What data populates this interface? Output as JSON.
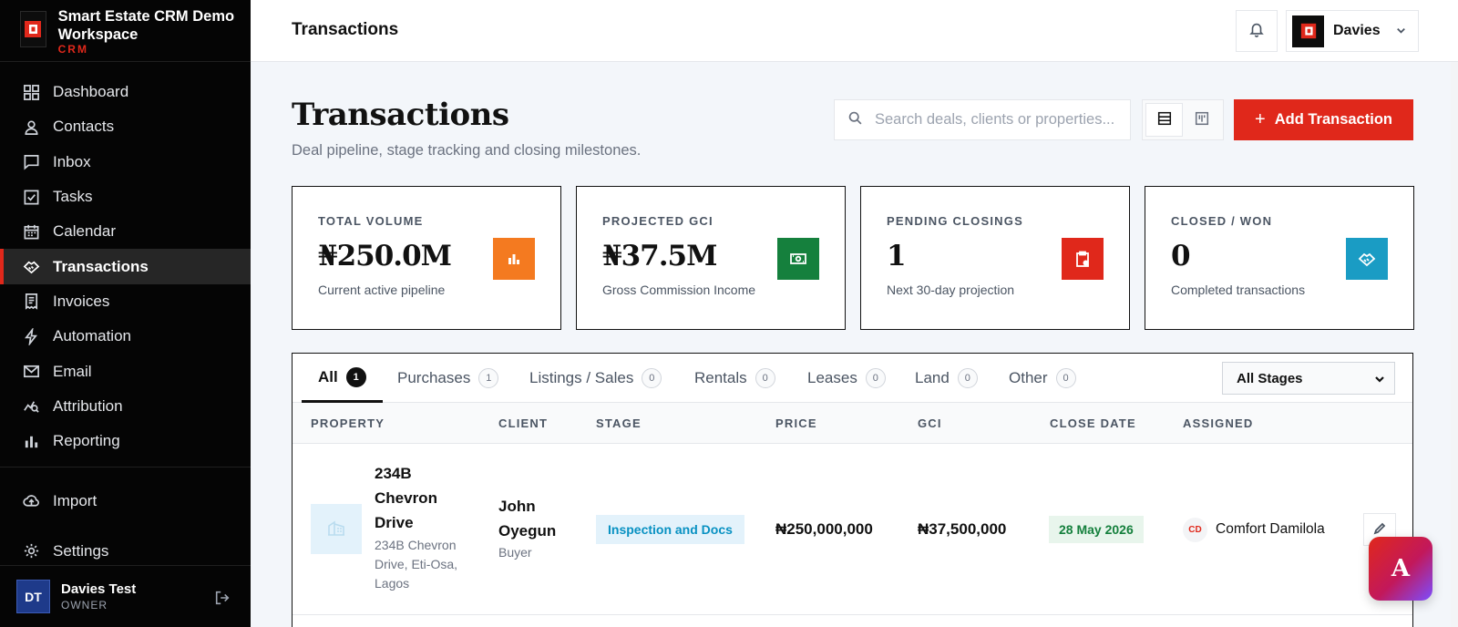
{
  "brand": {
    "name": "Smart Estate CRM Demo Workspace",
    "sub": "CRM"
  },
  "sidebar": {
    "items": [
      {
        "label": "Dashboard",
        "icon": "grid-icon"
      },
      {
        "label": "Contacts",
        "icon": "user-icon"
      },
      {
        "label": "Inbox",
        "icon": "message-icon"
      },
      {
        "label": "Tasks",
        "icon": "checkbox-icon"
      },
      {
        "label": "Calendar",
        "icon": "calendar-icon"
      },
      {
        "label": "Transactions",
        "icon": "handshake-icon",
        "active": true
      },
      {
        "label": "Invoices",
        "icon": "receipt-icon"
      },
      {
        "label": "Automation",
        "icon": "bolt-icon"
      },
      {
        "label": "Email",
        "icon": "mail-icon"
      },
      {
        "label": "Attribution",
        "icon": "analytics-icon"
      },
      {
        "label": "Reporting",
        "icon": "bar-chart-icon"
      }
    ],
    "bottom_items": [
      {
        "label": "Import",
        "icon": "cloud-upload-icon"
      },
      {
        "label": "Settings",
        "icon": "gear-icon"
      }
    ],
    "user": {
      "initials": "DT",
      "name": "Davies Test",
      "role": "OWNER"
    }
  },
  "topbar": {
    "title": "Transactions",
    "account_name": "Davies"
  },
  "page": {
    "title": "Transactions",
    "subtitle": "Deal pipeline, stage tracking and closing milestones.",
    "search_placeholder": "Search deals, clients or properties...",
    "add_label": "Add Transaction"
  },
  "stats": [
    {
      "label": "TOTAL VOLUME",
      "value": "₦250.0M",
      "note": "Current active pipeline",
      "icon": "bar-chart-icon",
      "color": "#f47a20"
    },
    {
      "label": "PROJECTED GCI",
      "value": "₦37.5M",
      "note": "Gross Commission Income",
      "icon": "cash-icon",
      "color": "#15803d"
    },
    {
      "label": "PENDING CLOSINGS",
      "value": "1",
      "note": "Next 30-day projection",
      "icon": "clipboard-alert-icon",
      "color": "#e0281b"
    },
    {
      "label": "CLOSED / WON",
      "value": "0",
      "note": "Completed transactions",
      "icon": "handshake-icon",
      "color": "#1a9cc4"
    }
  ],
  "tabs": [
    {
      "label": "All",
      "count": "1",
      "active": true
    },
    {
      "label": "Purchases",
      "count": "1"
    },
    {
      "label": "Listings / Sales",
      "count": "0"
    },
    {
      "label": "Rentals",
      "count": "0"
    },
    {
      "label": "Leases",
      "count": "0"
    },
    {
      "label": "Land",
      "count": "0"
    },
    {
      "label": "Other",
      "count": "0"
    }
  ],
  "stage_filter": "All Stages",
  "table": {
    "headers": [
      "PROPERTY",
      "CLIENT",
      "STAGE",
      "PRICE",
      "GCI",
      "CLOSE DATE",
      "ASSIGNED"
    ],
    "rows": [
      {
        "property_name": "234B Chevron Drive",
        "property_address": "234B Chevron Drive, Eti-Osa, Lagos",
        "client_name": "John Oyegun",
        "client_role": "Buyer",
        "stage": "Inspection and Docs",
        "price": "₦250,000,000",
        "gci": "₦37,500,000",
        "close_date": "28 May 2026",
        "assigned_initials": "CD",
        "assigned_name": "Comfort Damilola"
      }
    ]
  },
  "fab_letter": "A"
}
